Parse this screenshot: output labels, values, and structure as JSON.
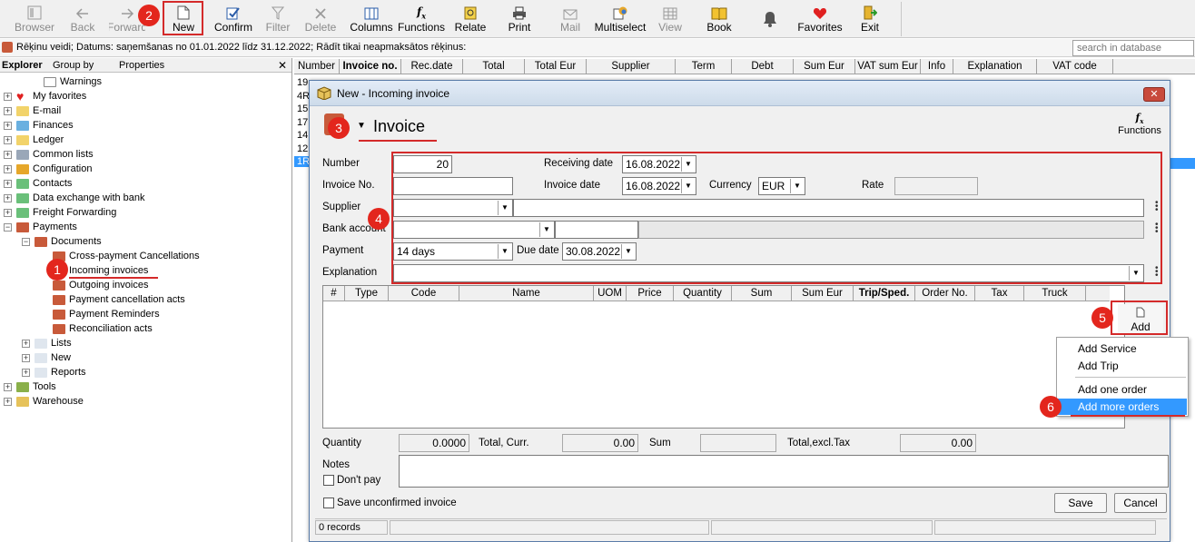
{
  "toolbar": {
    "buttons": [
      {
        "label": "Browser",
        "icon": "browser-icon",
        "enabled": false
      },
      {
        "label": "Back",
        "icon": "back-arrow-icon",
        "enabled": false
      },
      {
        "label": "Forward",
        "icon": "forward-arrow-icon",
        "enabled": false
      },
      {
        "label": "New",
        "icon": "new-document-icon",
        "enabled": true
      },
      {
        "label": "Confirm",
        "icon": "confirm-icon",
        "enabled": true
      },
      {
        "label": "Filter",
        "icon": "filter-icon",
        "enabled": false
      },
      {
        "label": "Delete",
        "icon": "delete-icon",
        "enabled": false
      },
      {
        "label": "Columns",
        "icon": "columns-icon",
        "enabled": true
      },
      {
        "label": "Functions",
        "icon": "functions-icon",
        "enabled": true
      },
      {
        "label": "Relate",
        "icon": "relate-icon",
        "enabled": true
      },
      {
        "label": "Print",
        "icon": "print-icon",
        "enabled": true
      },
      {
        "label": "Mail",
        "icon": "mail-icon",
        "enabled": false
      },
      {
        "label": "Multiselect",
        "icon": "multiselect-icon",
        "enabled": true
      },
      {
        "label": "View",
        "icon": "view-icon",
        "enabled": false
      },
      {
        "label": "Book",
        "icon": "book-icon",
        "enabled": true
      },
      {
        "label": "",
        "icon": "bell-icon",
        "enabled": true
      },
      {
        "label": "Favorites",
        "icon": "heart-icon",
        "enabled": true
      },
      {
        "label": "Exit",
        "icon": "exit-icon",
        "enabled": true
      }
    ]
  },
  "status_line": "Rēķinu veidi; Datums: saņemšanas no 01.01.2022 līdz 31.12.2022; Rādīt tikai neapmaksātos rēķinus:",
  "search": {
    "placeholder": "search in database"
  },
  "explorer": {
    "tabs": [
      "Explorer",
      "Group by",
      "Properties"
    ],
    "close": "✕",
    "tree": [
      {
        "label": "Warnings"
      },
      {
        "label": "My favorites"
      },
      {
        "label": "E-mail"
      },
      {
        "label": "Finances"
      },
      {
        "label": "Ledger"
      },
      {
        "label": "Common lists"
      },
      {
        "label": "Configuration"
      },
      {
        "label": "Contacts"
      },
      {
        "label": "Data exchange with bank"
      },
      {
        "label": "Freight Forwarding"
      },
      {
        "label": "Payments"
      },
      {
        "label": "Documents"
      },
      {
        "label": "Cross-payment Cancellations"
      },
      {
        "label": "Incoming invoices"
      },
      {
        "label": "Outgoing invoices"
      },
      {
        "label": "Payment cancellation acts"
      },
      {
        "label": "Payment Reminders"
      },
      {
        "label": "Reconciliation acts"
      },
      {
        "label": "Lists"
      },
      {
        "label": "New"
      },
      {
        "label": "Reports"
      },
      {
        "label": "Tools"
      },
      {
        "label": "Warehouse"
      }
    ]
  },
  "grid": {
    "columns": [
      "Number",
      "Invoice no.",
      "Rec.date",
      "Total",
      "Total Eur",
      "Supplier",
      "Term",
      "Debt",
      "Sum Eur",
      "VAT sum Eur",
      "Info",
      "Explanation",
      "VAT code"
    ],
    "row_stubs": [
      "19",
      "4R",
      "15",
      "17",
      "14",
      "12",
      "1R"
    ]
  },
  "dialog": {
    "title": "New - Incoming invoice",
    "header_title": "Invoice",
    "functions_label": "Functions",
    "fields": {
      "number_label": "Number",
      "number_value": "20",
      "receiving_date_label": "Receiving date",
      "receiving_date_value": "16.08.2022",
      "invoice_no_label": "Invoice No.",
      "invoice_no_value": "",
      "invoice_date_label": "Invoice date",
      "invoice_date_value": "16.08.2022",
      "currency_label": "Currency",
      "currency_value": "EUR",
      "rate_label": "Rate",
      "rate_value": "",
      "supplier_label": "Supplier",
      "supplier_value": "",
      "bank_account_label": "Bank account",
      "bank_account_value": "",
      "payment_label": "Payment",
      "payment_value": "14 days",
      "due_date_label": "Due date",
      "due_date_value": "30.08.2022",
      "explanation_label": "Explanation",
      "explanation_value": ""
    },
    "item_columns": [
      "#",
      "Type",
      "Code",
      "Name",
      "UOM",
      "Price",
      "Quantity",
      "Sum",
      "Sum Eur",
      "Trip/Sped.",
      "Order No.",
      "Tax",
      "Truck"
    ],
    "add_button": "Add",
    "add_menu": [
      "Add Service",
      "Add Trip",
      "Add one order",
      "Add more orders"
    ],
    "totals": {
      "quantity_label": "Quantity",
      "quantity_value": "0.0000",
      "total_curr_label": "Total, Curr.",
      "total_curr_value": "0.00",
      "sum_label": "Sum",
      "sum_value": "",
      "total_excl_tax_label": "Total,excl.Tax",
      "total_excl_tax_value": "0.00"
    },
    "notes_label": "Notes",
    "dont_pay_label": "Don't pay",
    "save_unconfirmed_label": "Save unconfirmed invoice",
    "save_button": "Save",
    "cancel_button": "Cancel",
    "records": "0 records"
  },
  "annotations": [
    "1",
    "2",
    "3",
    "4",
    "5",
    "6"
  ],
  "colors": {
    "annotation_red": "#d42a2a",
    "menu_highlight": "#3399ff",
    "selection": "#3399ff"
  }
}
